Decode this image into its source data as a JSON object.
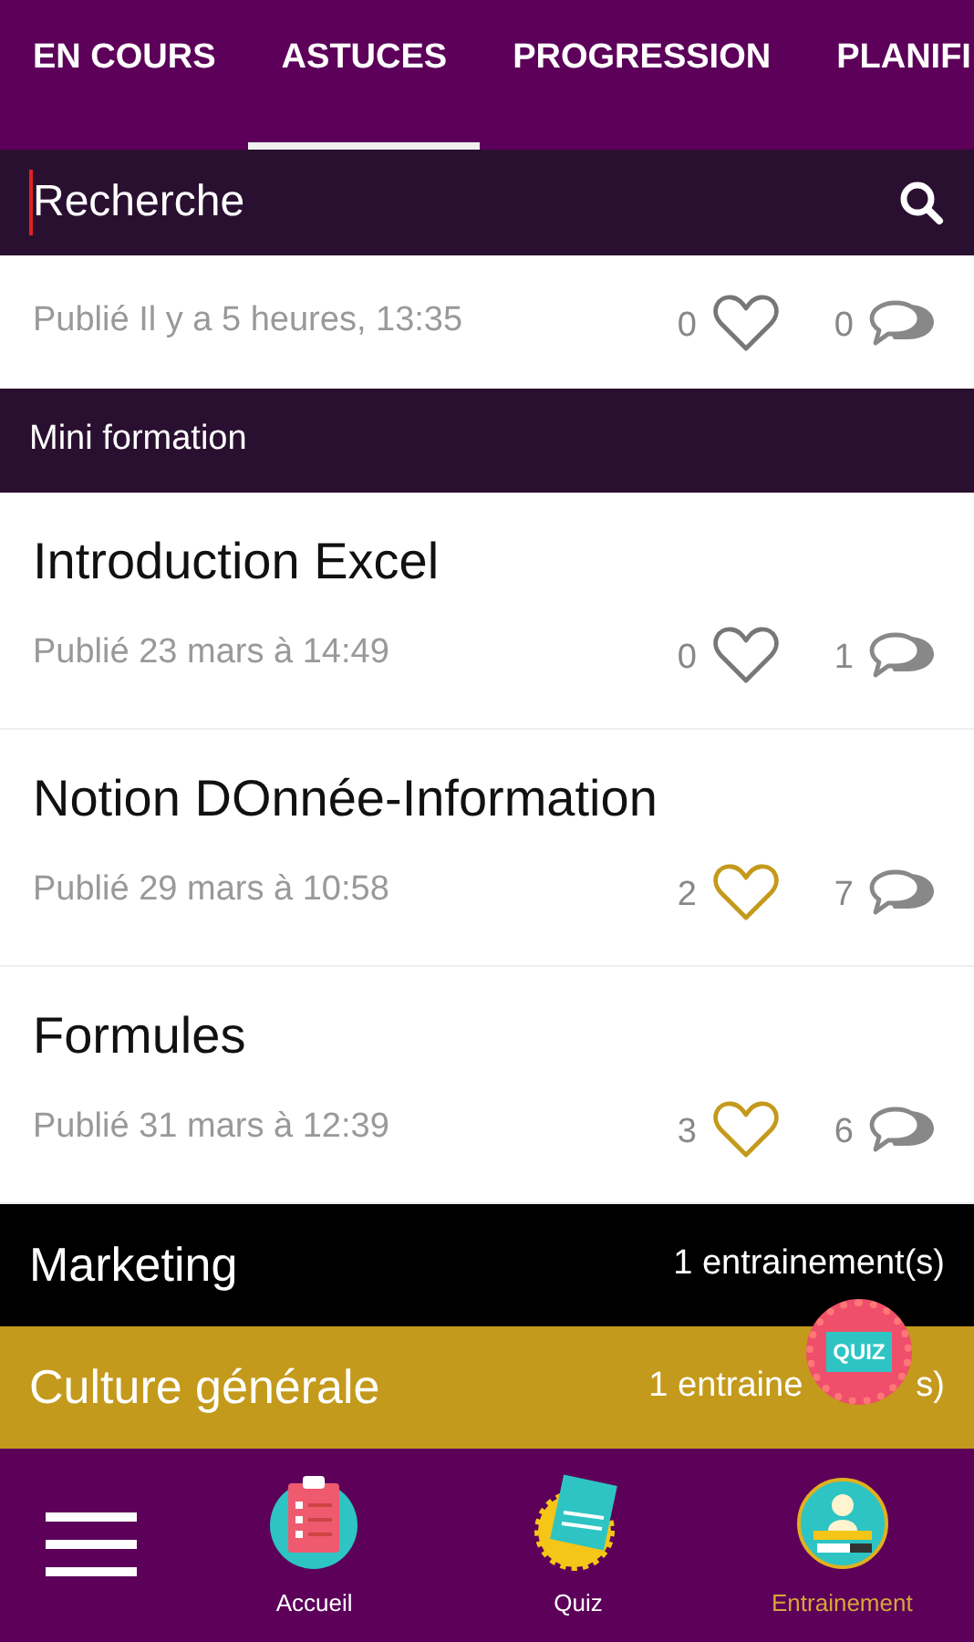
{
  "tabs": [
    {
      "label": "EN COURS",
      "selected": false
    },
    {
      "label": "ASTUCES",
      "selected": true
    },
    {
      "label": "PROGRESSION",
      "selected": false
    },
    {
      "label": "PLANIFI",
      "selected": false
    }
  ],
  "search": {
    "placeholder": "Recherche"
  },
  "top_post": {
    "published": "Publié Il y a 5 heures, 13:35",
    "likes": "0",
    "liked": false,
    "comments": "0"
  },
  "section": {
    "title": "Mini formation"
  },
  "posts": [
    {
      "title": "Introduction Excel",
      "published": "Publié 23 mars à 14:49",
      "likes": "0",
      "liked": false,
      "comments": "1"
    },
    {
      "title": "Notion DOnnée-Information",
      "published": "Publié 29 mars à 10:58",
      "likes": "2",
      "liked": true,
      "comments": "7"
    },
    {
      "title": "Formules",
      "published": "Publié 31 mars à 12:39",
      "likes": "3",
      "liked": true,
      "comments": "6"
    }
  ],
  "categories": [
    {
      "name": "Marketing",
      "count": "1 entrainement(s)",
      "color": "#000000"
    },
    {
      "name": "Culture générale",
      "count": "1 entraine",
      "count_tail": "s)",
      "color": "#c49a1c"
    }
  ],
  "quiz_badge": {
    "label": "QUIZ"
  },
  "bottom_nav": [
    {
      "label": "Accueil",
      "kind": "clipboard",
      "selected": false
    },
    {
      "label": "Quiz",
      "kind": "quiz",
      "selected": false
    },
    {
      "label": "Entrainement",
      "kind": "trainer",
      "selected": true
    }
  ]
}
